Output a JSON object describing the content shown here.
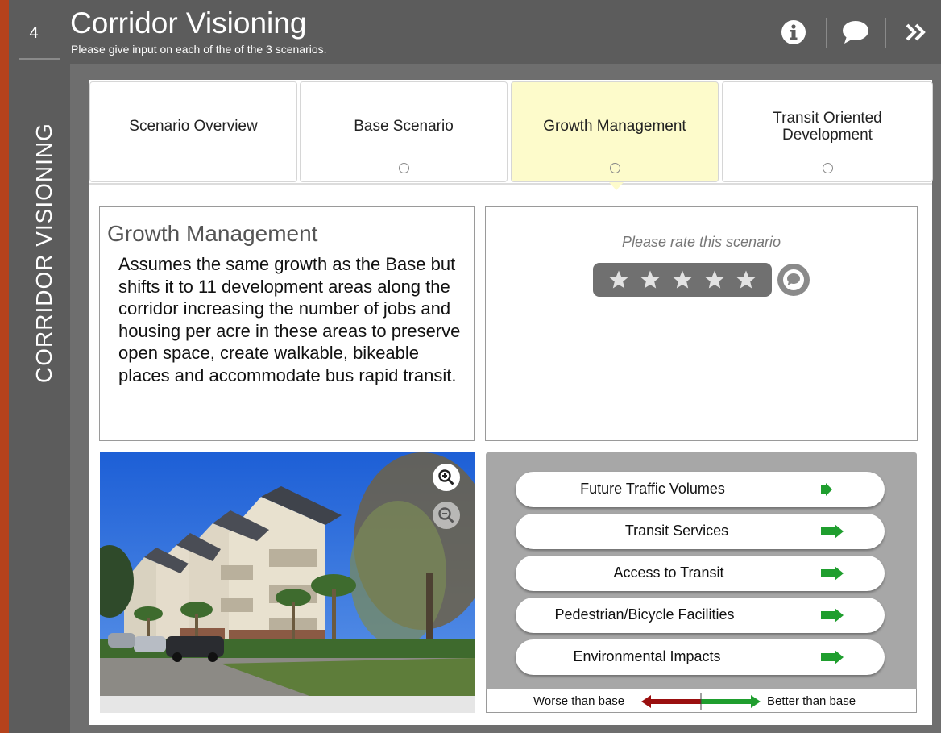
{
  "header": {
    "title": "Corridor Visioning",
    "subtitle": "Please give input on each of the of the 3 scenarios.",
    "icons": [
      "info-icon",
      "comment-icon",
      "double-chevron-right-icon"
    ]
  },
  "rail": {
    "step_number": "4",
    "title": "CORRIDOR VISIONING"
  },
  "tabs": [
    {
      "label": "Scenario Overview",
      "active": false,
      "has_dot": false
    },
    {
      "label": "Base Scenario",
      "active": false,
      "has_dot": true
    },
    {
      "label": "Growth Management",
      "active": true,
      "has_dot": true
    },
    {
      "label": "Transit Oriented Development",
      "active": false,
      "has_dot": true
    }
  ],
  "scenario": {
    "title": "Growth Management",
    "description": "Assumes the same growth as the Base but shifts it to 11 development areas along the corridor increasing the number of jobs and housing per acre in these areas to preserve open space, create walkable, bikeable places and accommodate bus rapid transit."
  },
  "rating": {
    "prompt": "Please rate this scenario",
    "max_stars": 5,
    "selected_stars": 0,
    "icons": [
      "star-icon",
      "comment-icon"
    ]
  },
  "photo": {
    "icons": [
      "zoom-in-icon",
      "zoom-out-icon"
    ]
  },
  "indicators": [
    {
      "label": "Future Traffic Volumes",
      "direction": "better",
      "size": "small"
    },
    {
      "label": "Transit Services",
      "direction": "better",
      "size": "large"
    },
    {
      "label": "Access to Transit",
      "direction": "better",
      "size": "large"
    },
    {
      "label": "Pedestrian/Bicycle Facilities",
      "direction": "better",
      "size": "large"
    },
    {
      "label": "Environmental Impacts",
      "direction": "better",
      "size": "large"
    }
  ],
  "legend": {
    "worse_label": "Worse than base",
    "better_label": "Better than base"
  },
  "colors": {
    "frame_dark": "#5c5c5c",
    "frame": "#6e6e6e",
    "accent_red": "#b5421c",
    "active_tab": "#fdfbcb",
    "better_green": "#1f9e2e",
    "worse_red": "#9a0f0f"
  }
}
